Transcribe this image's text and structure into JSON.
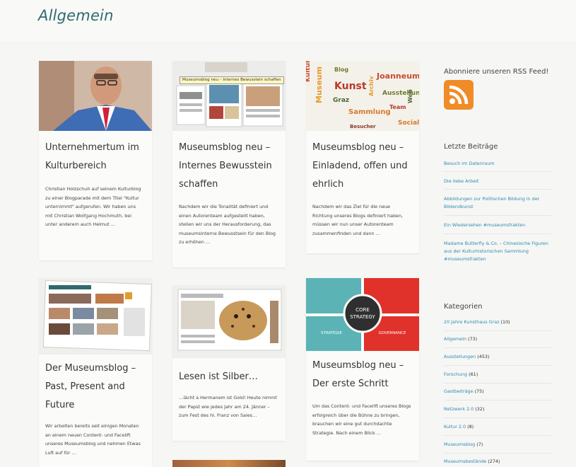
{
  "page_title": "Allgemein",
  "posts": [
    {
      "title": "Unternehmertum im Kulturbereich",
      "excerpt": "Christian Holzschuh auf seinem Kulturblog zu einer Blogparade mit dem Titel \"Kultur unternimmt\" aufgerufen. Wir haben uns mit Christian Wolfgang Hochmuth, bei unter anderem auch Helmut ...",
      "thumb": "portrait"
    },
    {
      "title": "Museumsblog neu – Internes Bewusstein schaffen",
      "excerpt": "Nachdem wir die Tonalität definiert und einen Autorenteam aufgestellt haben, stellen wir uns der Herausforderung, das museumsinterne Bewusstsein für den Blog zu erhöhen ...",
      "thumb": "blog-screens",
      "tooltip": "Museumsblog neu – Internes Bewusstein schaffen"
    },
    {
      "title": "Museumsblog neu – Einladend, offen und ehrlich",
      "excerpt": "Nachdem wir das Ziel für die neue Richtung unseres Blogs definiert haben, müssen wir nun unser Autorenteam zusammenfinden und dann ...",
      "thumb": "word-cloud"
    },
    {
      "title": "Der Museumsblog – Past, Present and Future",
      "excerpt": "Wir arbeiten bereits seit einigen Monaten an einem neuen Content- und Facelift unseres Museumsblog und nehmen Etwas Luft auf für ...",
      "thumb": "website"
    },
    {
      "title": "Lesen ist Silber…",
      "excerpt": "…lächt a Hermanem ist Gold! Heute nimmt der Papst wie jedes Jahr am 24. Jänner – zum Fest des hl. Franz von Sales…",
      "thumb": "cheetah"
    },
    {
      "title": "Museumsblog neu – Der erste Schritt",
      "excerpt": "Um das Content- und Facelift unseres Blogs erfolgreich über die Bühne zu bringen, brauchen wir eine gut durchdachte Strategie. Nach einem Blick ...",
      "thumb": "core-strategy",
      "labels": {
        "center_line1": "CORE",
        "center_line2": "STRATEGY",
        "left": "STRATEGIE",
        "right": "GOVERNANCE"
      }
    }
  ],
  "sidebar": {
    "rss_title": "Abonniere unseren RSS Feed!",
    "recent_title": "Letzte Beiträge",
    "recent": [
      "Besuch im Datenraum",
      "Die liebe Arbeit",
      "Abbildungen zur Politischen Bildung in der Bildendkunst",
      "Ein Wiedersehen #museumsfrakten",
      "Madame Butterfly & Co. – Chinesische Figuren aus der Kulturhistorischen Sammlung #museumsfrakten"
    ],
    "categories_title": "Kategorien",
    "categories": [
      {
        "name": "20 Jahre Kunsthaus Graz",
        "count": "(10)"
      },
      {
        "name": "Allgemein",
        "count": "(73)"
      },
      {
        "name": "Ausstellungen",
        "count": "(453)"
      },
      {
        "name": "Forschung",
        "count": "(61)"
      },
      {
        "name": "Gastbeiträge",
        "count": "(75)"
      },
      {
        "name": "Netzwerk 2.0",
        "count": "(32)"
      },
      {
        "name": "Kultur 2.0",
        "count": "(8)"
      },
      {
        "name": "Museumsblog",
        "count": "(7)"
      },
      {
        "name": "Museumsbestände",
        "count": "(274)"
      }
    ]
  },
  "colors": {
    "title": "#2f6a6e",
    "link": "#2e8bb2",
    "rss": "#f08c28",
    "accent_red": "#e0322a",
    "accent_teal": "#5bb3b5"
  }
}
